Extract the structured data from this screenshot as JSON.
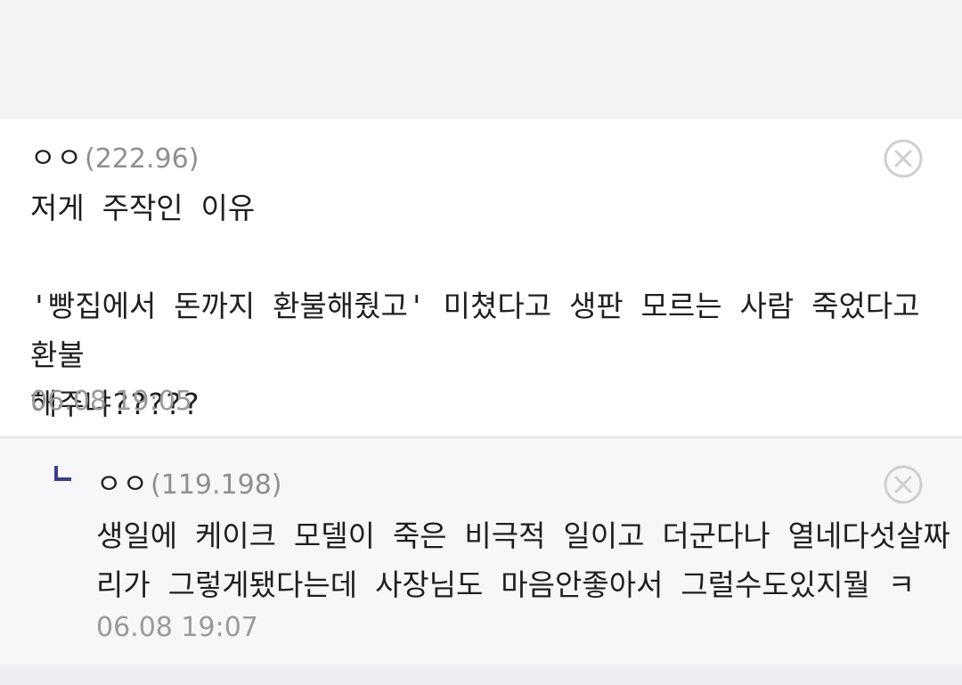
{
  "comment": {
    "nickname": "ㅇㅇ",
    "ip": "(222.96)",
    "body": "저게 주작인 이유\n\n'빵집에서 돈까지 환불해줬고' 미쳤다고 생판 모르는 사람 죽었다고 환불\n해주냐?????",
    "timestamp": "06.08 19:05",
    "delete_icon": "close-circle-icon"
  },
  "reply": {
    "reply_icon": "reply-arrow-icon",
    "nickname": "ㅇㅇ",
    "ip": "(119.198)",
    "body": "생일에 케이크 모델이 죽은 비극적 일이고 더군다나 열네다섯살짜\n리가 그렇게됐다는데 사장님도 마음안좋아서 그럴수도있지뭘 ㅋ",
    "timestamp": "06.08 19:07",
    "delete_icon": "close-circle-icon"
  },
  "colors": {
    "page_background": "#f3f3f6",
    "reply_background": "#f7f7fa",
    "reply_marker": "#3a3f8f",
    "muted_text": "#9a9a9a"
  }
}
